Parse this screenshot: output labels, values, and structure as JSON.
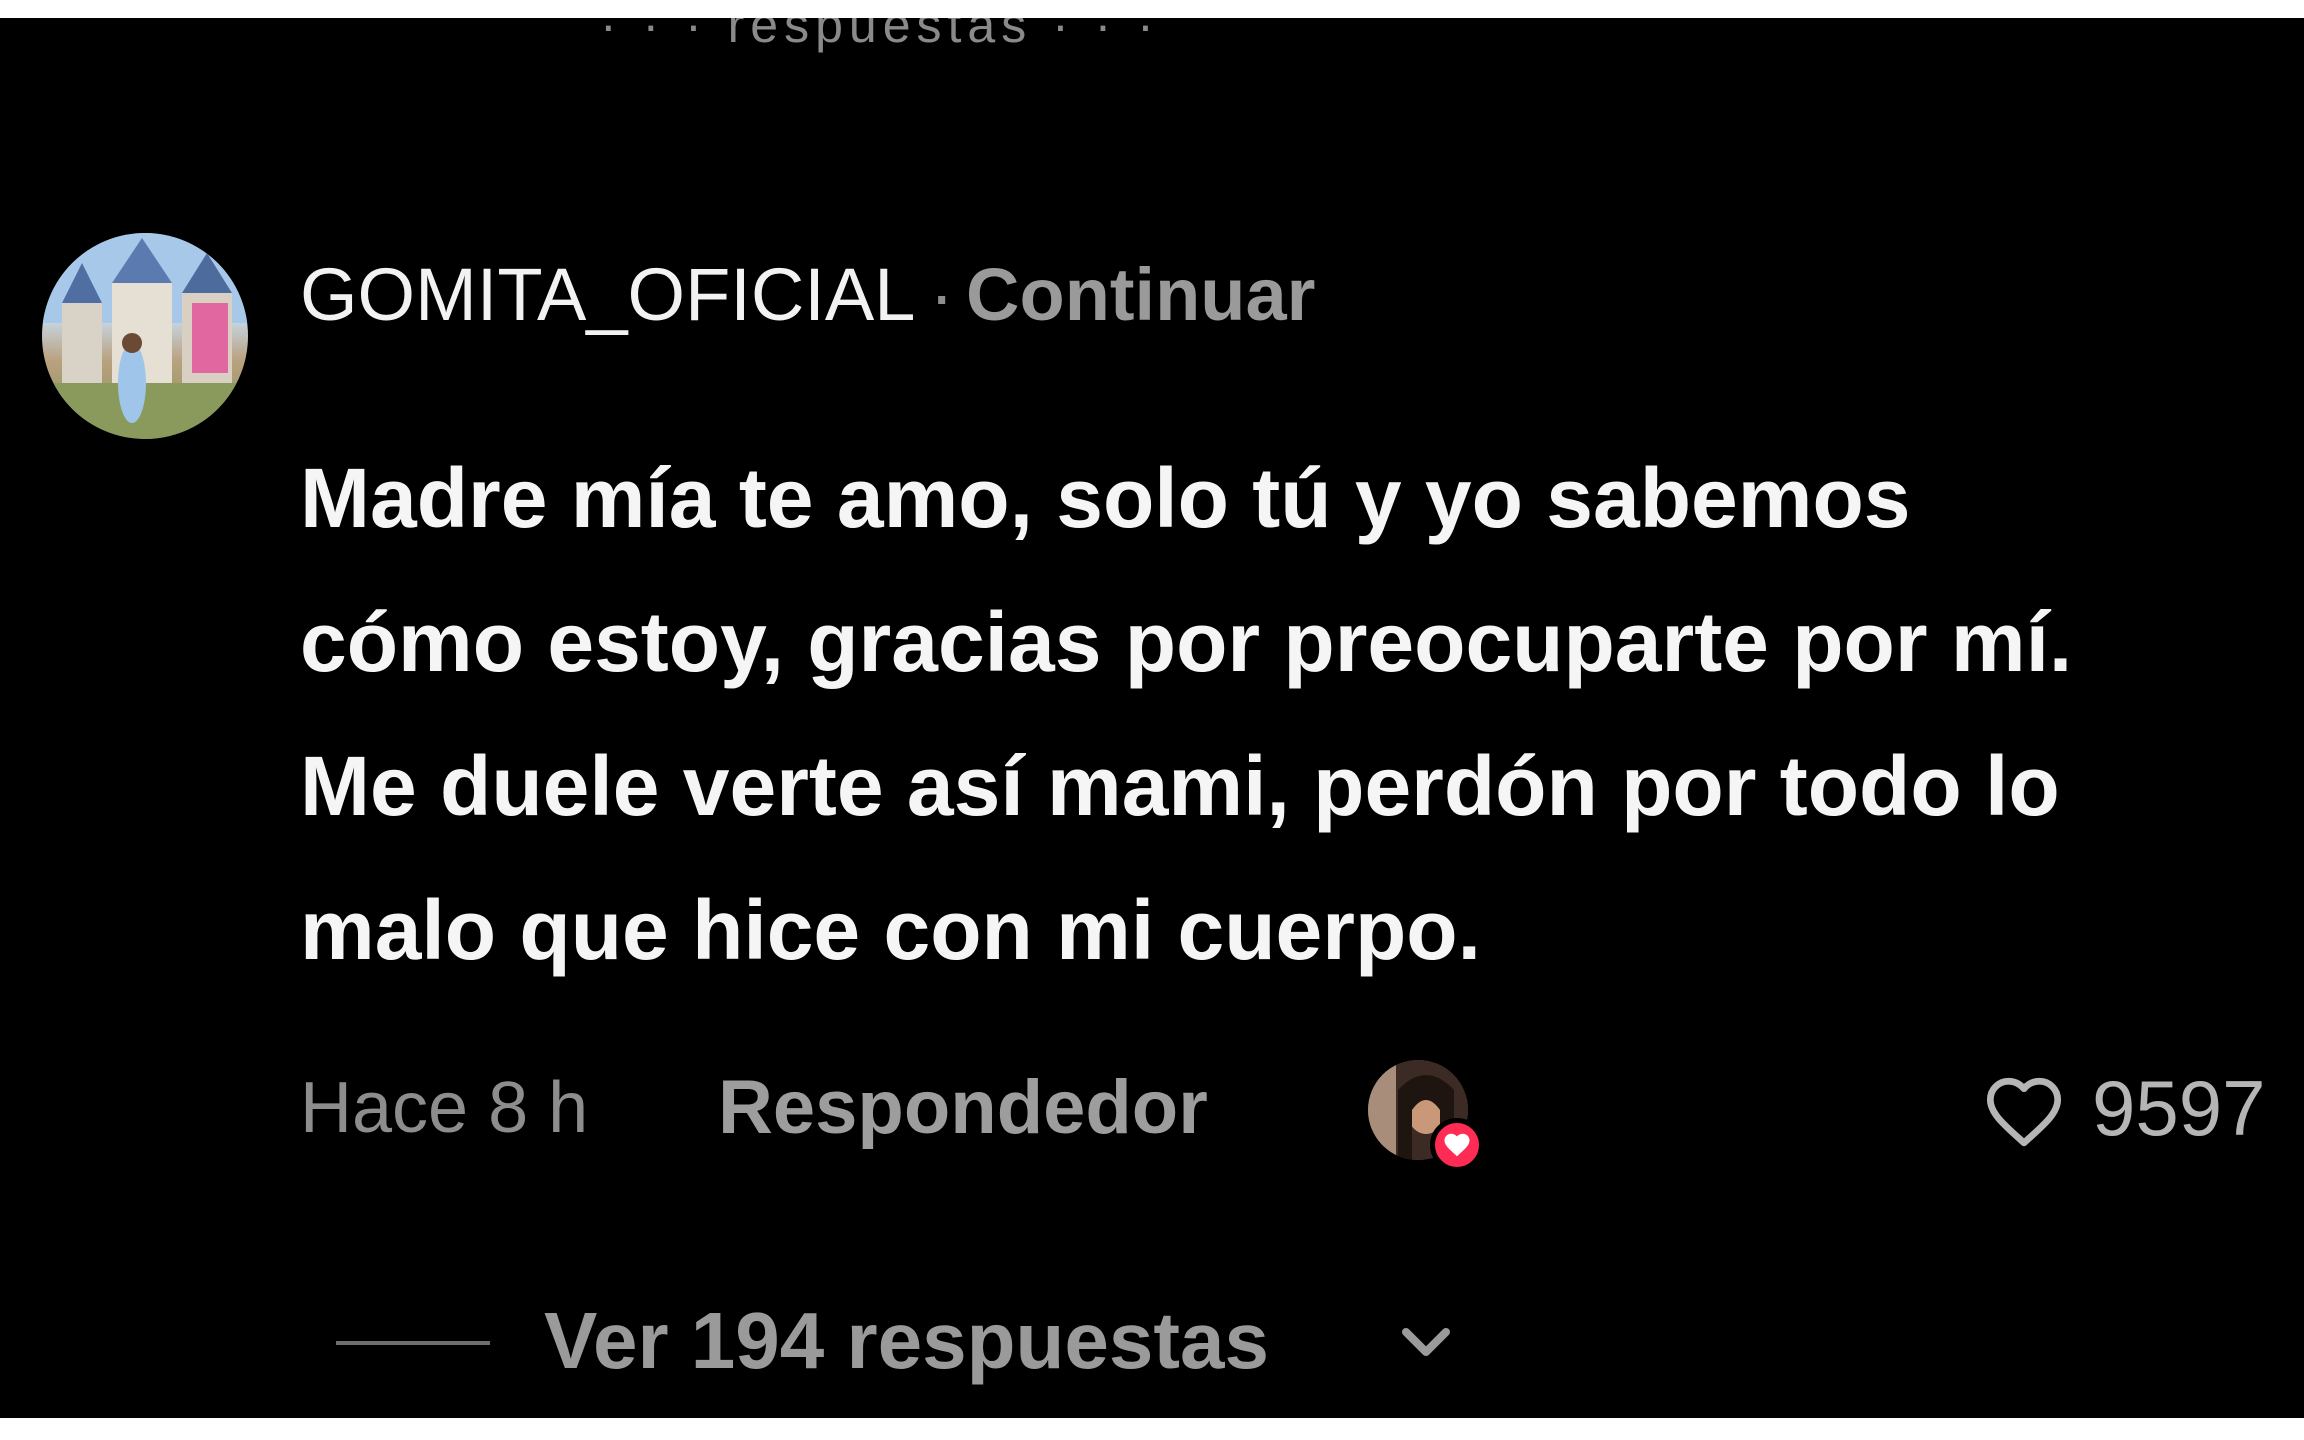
{
  "header": {
    "partial_text": "· · · respuestas · · ·"
  },
  "comment": {
    "username": "GOMITA_OFICIAL",
    "separator": "·",
    "follow_label": "Continuar",
    "text_lines": [
      "Madre mía te amo, solo tú y yo sabemos",
      "cómo estoy, gracias por preocuparte por mí.",
      "Me duele verte así mami, perdón por todo lo",
      "malo que hice con mi cuerpo."
    ],
    "time": "Hace 8 h",
    "reply_label": "Respondedor",
    "like_count": "9597",
    "view_replies_label": "Ver 194 respuestas"
  },
  "icons": {
    "like": "heart-outline-icon",
    "liked_by_creator": "heart-filled-icon",
    "expand": "chevron-down-icon"
  },
  "colors": {
    "background": "#000000",
    "primary_text": "#f5f5f5",
    "secondary_text": "#8d8d8d",
    "accent": "#fe2c55"
  }
}
